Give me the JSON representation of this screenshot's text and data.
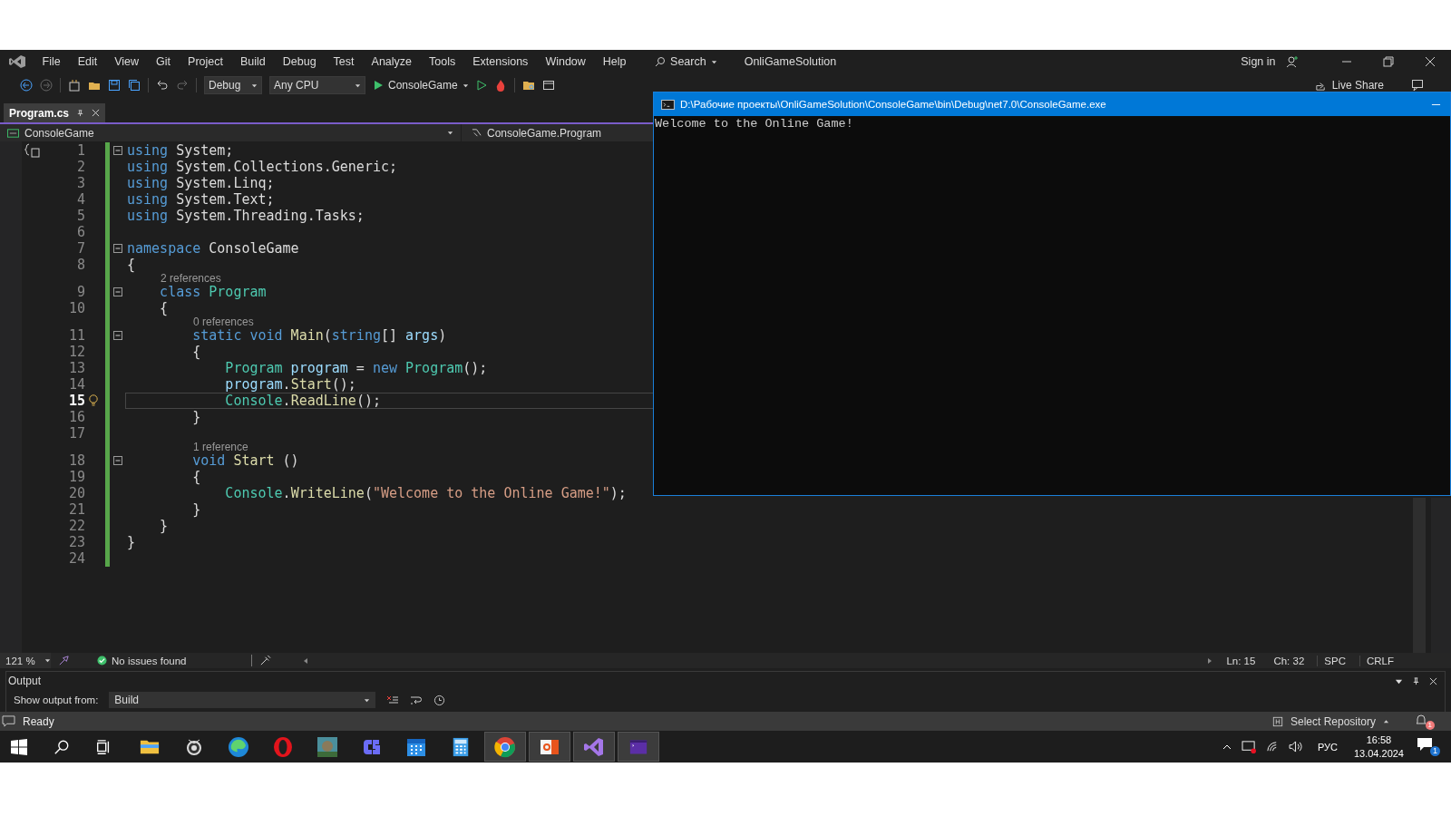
{
  "menu_bar": {
    "items": [
      "File",
      "Edit",
      "View",
      "Git",
      "Project",
      "Build",
      "Debug",
      "Test",
      "Analyze",
      "Tools",
      "Extensions",
      "Window",
      "Help"
    ],
    "search": "Search",
    "solution_name": "OnliGameSolution",
    "sign_in": "Sign in"
  },
  "toolbar": {
    "configuration": "Debug",
    "platform": "Any CPU",
    "start_target": "ConsoleGame",
    "live_share": "Live Share"
  },
  "editor_tabs": [
    {
      "label": "Program.cs",
      "selected": true
    }
  ],
  "navigation_bar": {
    "project": "ConsoleGame",
    "type": "ConsoleGame.Program"
  },
  "code_lines": [
    {
      "number": "1",
      "current": false,
      "foldable": true,
      "tokens": [
        {
          "kind": "keyword",
          "text": "using"
        },
        {
          "kind": "plain",
          "text": " System;"
        }
      ]
    },
    {
      "number": "2",
      "current": false,
      "foldable": false,
      "tokens": [
        {
          "kind": "keyword",
          "text": "using"
        },
        {
          "kind": "plain",
          "text": " System.Collections.Generic;"
        }
      ]
    },
    {
      "number": "3",
      "current": false,
      "foldable": false,
      "tokens": [
        {
          "kind": "keyword",
          "text": "using"
        },
        {
          "kind": "plain",
          "text": " System.Linq;"
        }
      ]
    },
    {
      "number": "4",
      "current": false,
      "foldable": false,
      "tokens": [
        {
          "kind": "keyword",
          "text": "using"
        },
        {
          "kind": "plain",
          "text": " System.Text;"
        }
      ]
    },
    {
      "number": "5",
      "current": false,
      "foldable": false,
      "tokens": [
        {
          "kind": "keyword",
          "text": "using"
        },
        {
          "kind": "plain",
          "text": " System.Threading.Tasks;"
        }
      ]
    },
    {
      "number": "6",
      "current": false,
      "foldable": false
    },
    {
      "number": "7",
      "current": false,
      "foldable": true,
      "tokens": [
        {
          "kind": "keyword",
          "text": "namespace"
        },
        {
          "kind": "plain",
          "text": " ConsoleGame"
        }
      ]
    },
    {
      "number": "8",
      "current": false,
      "foldable": false,
      "tokens": [
        {
          "kind": "plain",
          "text": "{"
        }
      ]
    },
    {
      "number": "9",
      "current": false,
      "foldable": true,
      "codelens": "2 references",
      "tokens": [
        {
          "kind": "keyword",
          "text": "    class"
        },
        {
          "kind": "type",
          "text": " Program"
        }
      ]
    },
    {
      "number": "10",
      "current": false,
      "foldable": false,
      "tokens": [
        {
          "kind": "plain",
          "text": "    {"
        }
      ]
    },
    {
      "number": "11",
      "current": false,
      "foldable": true,
      "codelens": "0 references",
      "tokens": [
        {
          "kind": "keyword",
          "text": "        static"
        },
        {
          "kind": "keyword",
          "text": " void"
        },
        {
          "kind": "method",
          "text": " Main"
        },
        {
          "kind": "plain",
          "text": "("
        },
        {
          "kind": "keyword",
          "text": "string"
        },
        {
          "kind": "plain",
          "text": "[]"
        },
        {
          "kind": "variable",
          "text": " args"
        },
        {
          "kind": "plain",
          "text": ")"
        }
      ]
    },
    {
      "number": "12",
      "current": false,
      "foldable": false,
      "tokens": [
        {
          "kind": "plain",
          "text": "        {"
        }
      ]
    },
    {
      "number": "13",
      "current": false,
      "foldable": false,
      "tokens": [
        {
          "kind": "type",
          "text": "            Program"
        },
        {
          "kind": "variable",
          "text": " program"
        },
        {
          "kind": "plain",
          "text": " ="
        },
        {
          "kind": "keyword",
          "text": " new"
        },
        {
          "kind": "type",
          "text": " Program"
        },
        {
          "kind": "plain",
          "text": "();"
        }
      ]
    },
    {
      "number": "14",
      "current": false,
      "foldable": false,
      "tokens": [
        {
          "kind": "variable",
          "text": "            program"
        },
        {
          "kind": "plain",
          "text": "."
        },
        {
          "kind": "method",
          "text": "Start"
        },
        {
          "kind": "plain",
          "text": "();"
        }
      ]
    },
    {
      "number": "15",
      "current": true,
      "foldable": false,
      "tokens": [
        {
          "kind": "type",
          "text": "            Console"
        },
        {
          "kind": "plain",
          "text": "."
        },
        {
          "kind": "method",
          "text": "ReadLine"
        },
        {
          "kind": "plain",
          "text": "();"
        }
      ]
    },
    {
      "number": "16",
      "current": false,
      "foldable": false,
      "tokens": [
        {
          "kind": "plain",
          "text": "        }"
        }
      ]
    },
    {
      "number": "17",
      "current": false,
      "foldable": false
    },
    {
      "number": "18",
      "current": false,
      "foldable": true,
      "codelens": "1 reference",
      "tokens": [
        {
          "kind": "keyword",
          "text": "        void"
        },
        {
          "kind": "method",
          "text": " Start"
        },
        {
          "kind": "plain",
          "text": " ()"
        }
      ]
    },
    {
      "number": "19",
      "current": false,
      "foldable": false,
      "tokens": [
        {
          "kind": "plain",
          "text": "        {"
        }
      ]
    },
    {
      "number": "20",
      "current": false,
      "foldable": false,
      "tokens": [
        {
          "kind": "type",
          "text": "            Console"
        },
        {
          "kind": "plain",
          "text": "."
        },
        {
          "kind": "method",
          "text": "WriteLine"
        },
        {
          "kind": "plain",
          "text": "("
        },
        {
          "kind": "string",
          "text": "\"Welcome to the Online Game!\""
        },
        {
          "kind": "plain",
          "text": ");"
        }
      ]
    },
    {
      "number": "21",
      "current": false,
      "foldable": false,
      "tokens": [
        {
          "kind": "plain",
          "text": "        }"
        }
      ]
    },
    {
      "number": "22",
      "current": false,
      "foldable": false,
      "tokens": [
        {
          "kind": "plain",
          "text": "    }"
        }
      ]
    },
    {
      "number": "23",
      "current": false,
      "foldable": false,
      "tokens": [
        {
          "kind": "plain",
          "text": "}"
        }
      ]
    },
    {
      "number": "24",
      "current": false,
      "foldable": false
    }
  ],
  "editor_status": {
    "zoom": "121 %",
    "issues": "No issues found",
    "line": "Ln: 15",
    "char": "Ch: 32",
    "whitespace": "SPC",
    "line_ending": "CRLF"
  },
  "output_panel": {
    "title": "Output",
    "show_from_label": "Show output from:",
    "source": "Build"
  },
  "status_bar": {
    "state": "Ready",
    "repository": "Select Repository",
    "notifications": "1"
  },
  "console_window": {
    "title": "D:\\Рабочие проекты\\OnliGameSolution\\ConsoleGame\\bin\\Debug\\net7.0\\ConsoleGame.exe",
    "output": [
      "Welcome to the Online Game!"
    ]
  },
  "taskbar": {
    "apps": [
      {
        "open": false
      },
      {
        "open": false
      },
      {
        "open": false
      },
      {
        "open": false
      },
      {
        "open": false
      },
      {
        "open": false
      },
      {
        "open": false
      },
      {
        "open": false
      },
      {
        "open": true
      },
      {
        "open": true
      },
      {
        "open": true
      },
      {
        "open": true
      }
    ],
    "language": "РУС",
    "time": "16:58",
    "date": "13.04.2024",
    "notifications": "1"
  }
}
